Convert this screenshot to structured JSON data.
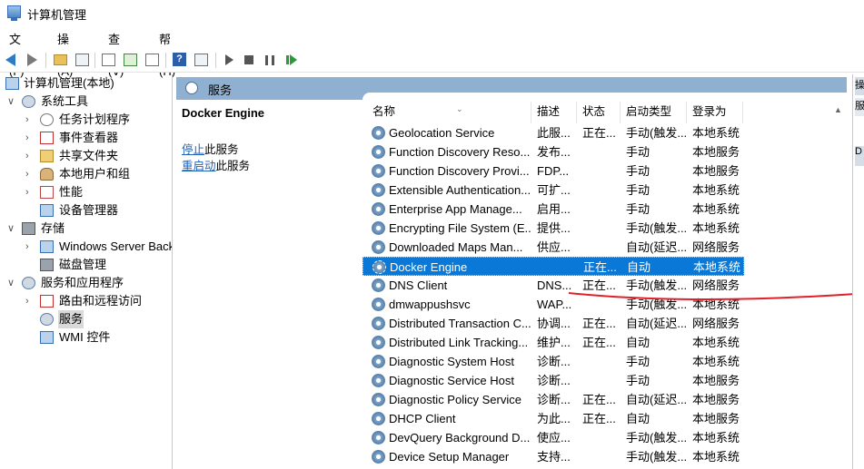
{
  "window": {
    "title": "计算机管理"
  },
  "menu": [
    "文件(F)",
    "操作(A)",
    "查看(V)",
    "帮助(H)"
  ],
  "toolbar": {
    "icons": [
      "back-icon",
      "forward-icon",
      "up-folder-icon",
      "show-hide-tree-icon",
      "properties-icon",
      "refresh-icon",
      "export-icon",
      "help-icon",
      "console-icon",
      "start-icon",
      "stop-icon",
      "pause-icon",
      "resume-icon"
    ]
  },
  "tree": {
    "items": [
      {
        "label": "计算机管理(本地)",
        "icon": "computer-icon",
        "level": 0
      },
      {
        "label": "系统工具",
        "icon": "tools-icon",
        "level": 1,
        "expanded": true
      },
      {
        "label": "任务计划程序",
        "icon": "clock-icon",
        "level": 2
      },
      {
        "label": "事件查看器",
        "icon": "event-viewer-icon",
        "level": 2
      },
      {
        "label": "共享文件夹",
        "icon": "folder-icon",
        "level": 2
      },
      {
        "label": "本地用户和组",
        "icon": "users-icon",
        "level": 2
      },
      {
        "label": "性能",
        "icon": "performance-icon",
        "level": 2
      },
      {
        "label": "设备管理器",
        "icon": "device-manager-icon",
        "level": 2
      },
      {
        "label": "存储",
        "icon": "storage-icon",
        "level": 1,
        "expanded": true
      },
      {
        "label": "Windows Server Back",
        "icon": "backup-icon",
        "level": 2
      },
      {
        "label": "磁盘管理",
        "icon": "disk-icon",
        "level": 2
      },
      {
        "label": "服务和应用程序",
        "icon": "services-apps-icon",
        "level": 1,
        "expanded": true
      },
      {
        "label": "路由和远程访问",
        "icon": "routing-icon",
        "level": 2
      },
      {
        "label": "服务",
        "icon": "services-icon",
        "level": 2,
        "selected": true
      },
      {
        "label": "WMI 控件",
        "icon": "wmi-icon",
        "level": 2
      }
    ]
  },
  "services_header": {
    "title": "服务"
  },
  "detail": {
    "title": "Docker Engine",
    "stop_link": "停止",
    "stop_suffix": "此服务",
    "restart_link": "重启动",
    "restart_suffix": "此服务"
  },
  "columns": [
    "名称",
    "描述",
    "状态",
    "启动类型",
    "登录为"
  ],
  "rows": [
    {
      "name": "Geolocation Service",
      "desc": "此服...",
      "status": "正在...",
      "startup": "手动(触发...",
      "logon": "本地系统"
    },
    {
      "name": "Function Discovery Reso...",
      "desc": "发布...",
      "status": "",
      "startup": "手动",
      "logon": "本地服务"
    },
    {
      "name": "Function Discovery Provi...",
      "desc": "FDP...",
      "status": "",
      "startup": "手动",
      "logon": "本地服务"
    },
    {
      "name": "Extensible Authentication...",
      "desc": "可扩...",
      "status": "",
      "startup": "手动",
      "logon": "本地系统"
    },
    {
      "name": "Enterprise App Manage...",
      "desc": "启用...",
      "status": "",
      "startup": "手动",
      "logon": "本地系统"
    },
    {
      "name": "Encrypting File System (E...",
      "desc": "提供...",
      "status": "",
      "startup": "手动(触发...",
      "logon": "本地系统"
    },
    {
      "name": "Downloaded Maps Man...",
      "desc": "供应...",
      "status": "",
      "startup": "自动(延迟...",
      "logon": "网络服务"
    },
    {
      "name": "Docker Engine",
      "desc": "",
      "status": "正在...",
      "startup": "自动",
      "logon": "本地系统",
      "selected": true
    },
    {
      "name": "DNS Client",
      "desc": "DNS...",
      "status": "正在...",
      "startup": "手动(触发...",
      "logon": "网络服务"
    },
    {
      "name": "dmwappushsvc",
      "desc": "WAP...",
      "status": "",
      "startup": "手动(触发...",
      "logon": "本地系统"
    },
    {
      "name": "Distributed Transaction C...",
      "desc": "协调...",
      "status": "正在...",
      "startup": "自动(延迟...",
      "logon": "网络服务"
    },
    {
      "name": "Distributed Link Tracking...",
      "desc": "维护...",
      "status": "正在...",
      "startup": "自动",
      "logon": "本地系统"
    },
    {
      "name": "Diagnostic System Host",
      "desc": "诊断...",
      "status": "",
      "startup": "手动",
      "logon": "本地系统"
    },
    {
      "name": "Diagnostic Service Host",
      "desc": "诊断...",
      "status": "",
      "startup": "手动",
      "logon": "本地服务"
    },
    {
      "name": "Diagnostic Policy Service",
      "desc": "诊断...",
      "status": "正在...",
      "startup": "自动(延迟...",
      "logon": "本地服务"
    },
    {
      "name": "DHCP Client",
      "desc": "为此...",
      "status": "正在...",
      "startup": "自动",
      "logon": "本地服务"
    },
    {
      "name": "DevQuery Background D...",
      "desc": "使应...",
      "status": "",
      "startup": "手动(触发...",
      "logon": "本地系统"
    },
    {
      "name": "Device Setup Manager",
      "desc": "支持...",
      "status": "",
      "startup": "手动(触发...",
      "logon": "本地系统"
    }
  ],
  "actions_strip": {
    "t1": "操",
    "t2": "服",
    "t3": "D"
  },
  "colors": {
    "selection": "#0a78d7",
    "header_band": "#8fb0d1",
    "link": "#2161b5",
    "annotation": "#e0202a"
  }
}
